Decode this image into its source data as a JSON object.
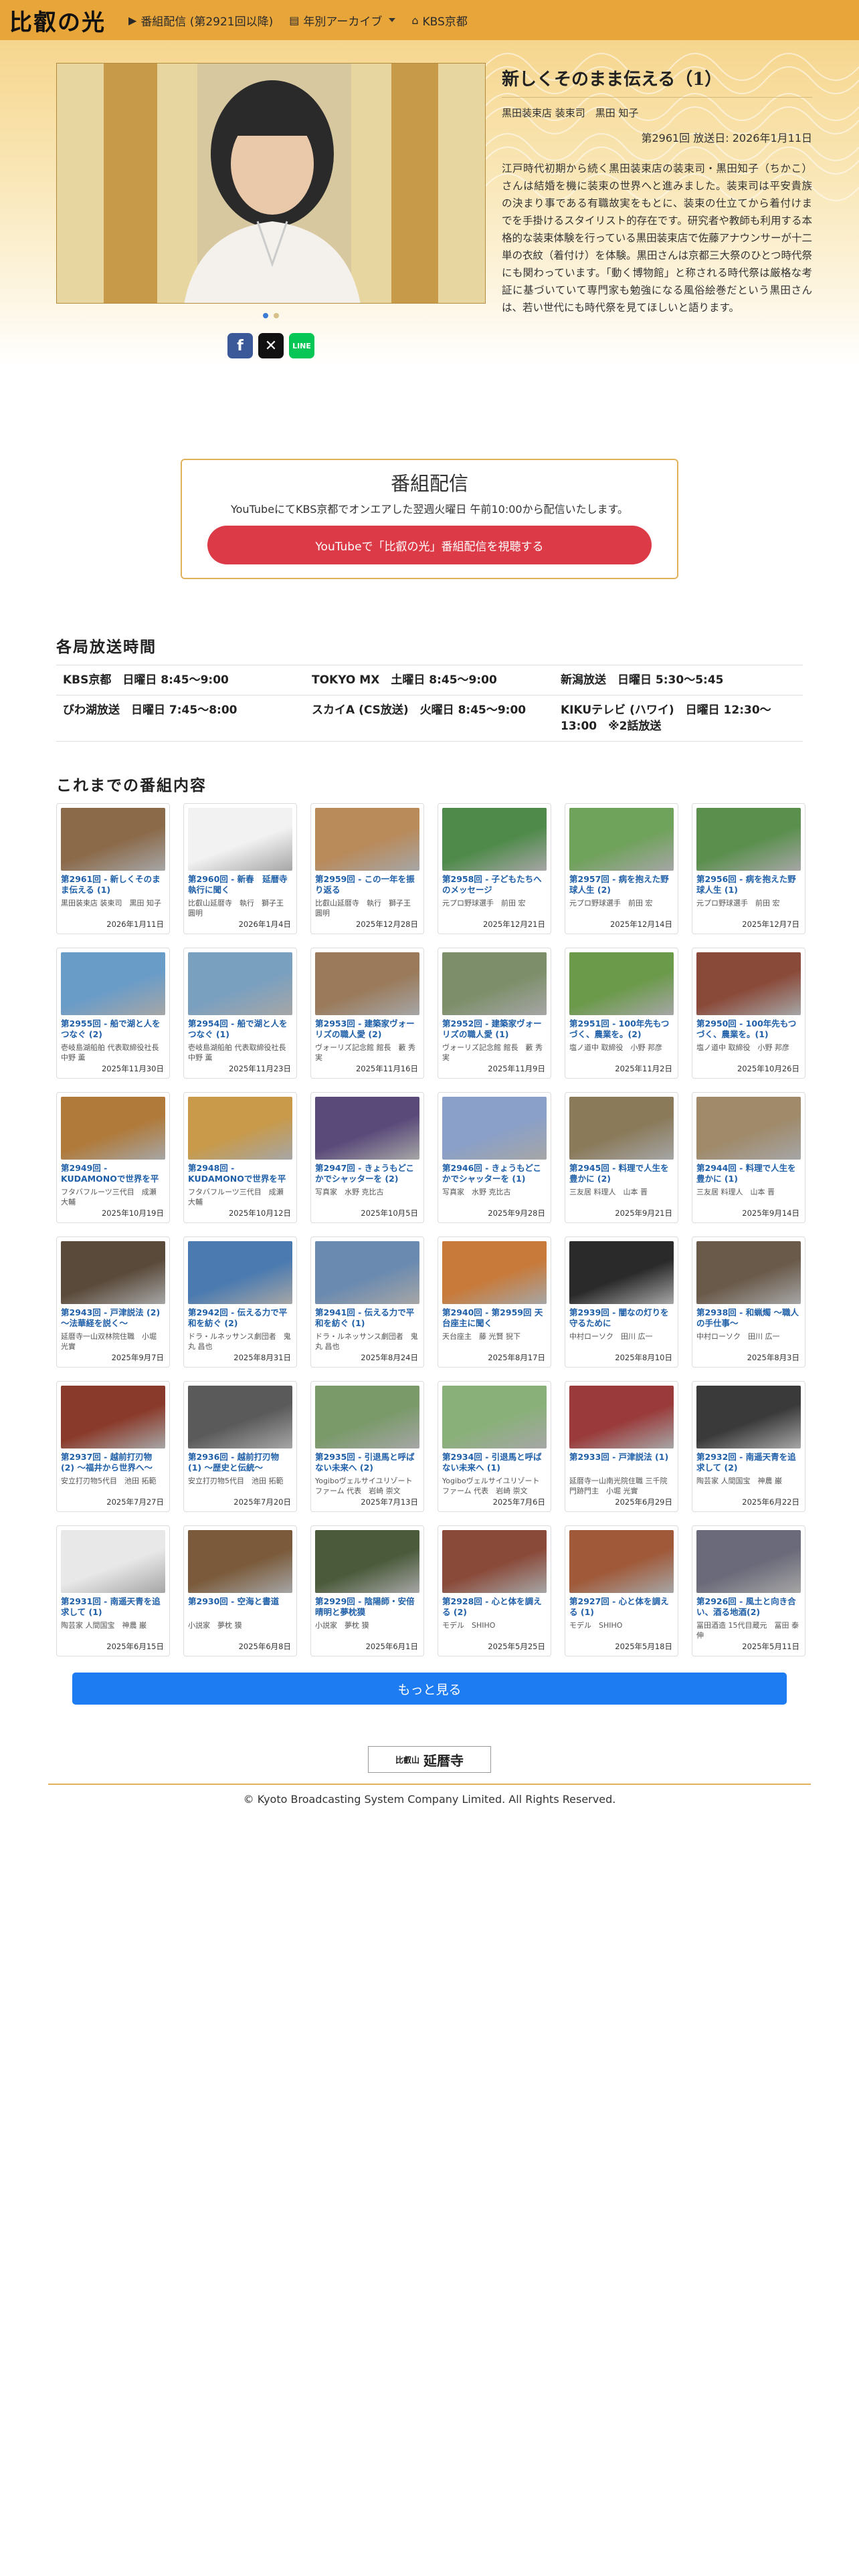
{
  "nav": {
    "brand": "比叡の光",
    "items": [
      {
        "icon": "video-icon",
        "label": "番組配信 (第2921回以降)"
      },
      {
        "icon": "archive-icon",
        "label": "年別アーカイブ"
      },
      {
        "icon": "home-icon",
        "label": "KBS京都"
      }
    ]
  },
  "hero": {
    "title": "新しくそのまま伝える（1）",
    "guest": "黒田装束店 装束司　黒田 知子",
    "airdate": "第2961回 放送日: 2026年1月11日",
    "summary": "江戸時代初期から続く黒田装束店の装束司・黒田知子（ちかこ）さんは結婚を機に装束の世界へと進みました。装束司は平安貴族の決まり事である有職故実をもとに、装束の仕立てから着付けまでを手掛けるスタイリスト的存在です。研究者や教師も利用する本格的な装束体験を行っている黒田装束店で佐藤アナウンサーが十二単の衣紋（着付け）を体験。黒田さんは京都三大祭のひとつ時代祭にも関わっています。「動く博物館」と称される時代祭は厳格な考証に基づいていて専門家も勉強になる風俗絵巻だという黒田さんは、若い世代にも時代祭を見てほしいと語ります。"
  },
  "streaming": {
    "heading": "番組配信",
    "text": "YouTubeにてKBS京都でオンエアした翌週火曜日 午前10:00から配信いたします。",
    "button": "YouTubeで「比叡の光」番組配信を視聴する"
  },
  "schedule": {
    "title": "各局放送時間",
    "rows": [
      [
        "KBS京都　日曜日 8:45〜9:00",
        "TOKYO MX　土曜日 8:45〜9:00",
        "新潟放送　日曜日 5:30〜5:45"
      ],
      [
        "びわ湖放送　日曜日 7:45〜8:00",
        "スカイA (CS放送)　火曜日 8:45〜9:00",
        "KIKUテレビ (ハワイ)　日曜日 12:30〜13:00　※2話放送"
      ]
    ]
  },
  "episodes": {
    "title": "これまでの番組内容",
    "items": [
      {
        "title": "第2961回 - 新しくそのまま伝える (1)",
        "guest": "黒田装束店 装束司　黒田 知子",
        "date": "2026年1月11日",
        "color": "#8b6a4a"
      },
      {
        "title": "第2960回 - 新春　延暦寺執行に聞く",
        "guest": "比叡山延暦寺　執行　獅子王 圓明",
        "date": "2026年1月4日",
        "color": "#f2f2f2"
      },
      {
        "title": "第2959回 - この一年を振り返る",
        "guest": "比叡山延暦寺　執行　獅子王 圓明",
        "date": "2025年12月28日",
        "color": "#b98a5a"
      },
      {
        "title": "第2958回 - 子どもたちへのメッセージ",
        "guest": "元プロ野球選手　前田 宏",
        "date": "2025年12月21日",
        "color": "#4f8a4a"
      },
      {
        "title": "第2957回 - 病を抱えた野球人生 (2)",
        "guest": "元プロ野球選手　前田 宏",
        "date": "2025年12月14日",
        "color": "#6fa25a"
      },
      {
        "title": "第2956回 - 病を抱えた野球人生 (1)",
        "guest": "元プロ野球選手　前田 宏",
        "date": "2025年12月7日",
        "color": "#5b8f4e"
      },
      {
        "title": "第2955回 - 船で湖と人をつなぐ (2)",
        "guest": "壱岐島湖船舶 代表取締役社長　中野 薫",
        "date": "2025年11月30日",
        "color": "#6a9cc8"
      },
      {
        "title": "第2954回 - 船で湖と人をつなぐ (1)",
        "guest": "壱岐島湖船舶 代表取締役社長　中野 薫",
        "date": "2025年11月23日",
        "color": "#7aa0c0"
      },
      {
        "title": "第2953回 - 建築家ヴォーリズの職人愛 (2)",
        "guest": "ヴォーリズ記念館 館長　藪 秀実",
        "date": "2025年11月16日",
        "color": "#9a7a5a"
      },
      {
        "title": "第2952回 - 建築家ヴォーリズの職人愛 (1)",
        "guest": "ヴォーリズ記念館 館長　藪 秀実",
        "date": "2025年11月9日",
        "color": "#7d8f6a"
      },
      {
        "title": "第2951回 - 100年先もつづく、農業を。(2)",
        "guest": "塩ノ道中 取締役　小野 邦彦",
        "date": "2025年11月2日",
        "color": "#6b9a4a"
      },
      {
        "title": "第2950回 - 100年先もつづく、農業を。(1)",
        "guest": "塩ノ道中 取締役　小野 邦彦",
        "date": "2025年10月26日",
        "color": "#8a4a3a"
      },
      {
        "title": "第2949回 - KUDAMONOで世界を平和に (2)",
        "guest": "フタバフルーツ三代目　成瀬 大輔",
        "date": "2025年10月19日",
        "color": "#b07a3a"
      },
      {
        "title": "第2948回 - KUDAMONOで世界を平和に (1)",
        "guest": "フタバフルーツ三代目　成瀬 大輔",
        "date": "2025年10月12日",
        "color": "#c89a4a"
      },
      {
        "title": "第2947回 - きょうもどこかでシャッターを (2)",
        "guest": "写真家　水野 克比古",
        "date": "2025年10月5日",
        "color": "#5a4a7a"
      },
      {
        "title": "第2946回 - きょうもどこかでシャッターを (1)",
        "guest": "写真家　水野 克比古",
        "date": "2025年9月28日",
        "color": "#8aa0c8"
      },
      {
        "title": "第2945回 - 料理で人生を豊かに (2)",
        "guest": "三友居 料理人　山本 晋",
        "date": "2025年9月21日",
        "color": "#8a7a5a"
      },
      {
        "title": "第2944回 - 料理で人生を豊かに (1)",
        "guest": "三友居 料理人　山本 晋",
        "date": "2025年9月14日",
        "color": "#a08a6a"
      },
      {
        "title": "第2943回 - 戸津説法 (2) 〜法華経を説く〜",
        "guest": "延暦寺一山双林院住職　小堀 光實",
        "date": "2025年9月7日",
        "color": "#5a4a3a"
      },
      {
        "title": "第2942回 - 伝える力で平和を紡ぐ (2)",
        "guest": "ドラ・ルネッサンス劇団者　鬼丸 昌也",
        "date": "2025年8月31日",
        "color": "#4a7ab0"
      },
      {
        "title": "第2941回 - 伝える力で平和を紡ぐ (1)",
        "guest": "ドラ・ルネッサンス劇団者　鬼丸 昌也",
        "date": "2025年8月24日",
        "color": "#6a8ab0"
      },
      {
        "title": "第2940回 - 第2959回 天台座主に聞く",
        "guest": "天台座主　藤 光賢 猊下",
        "date": "2025年8月17日",
        "color": "#c87a3a"
      },
      {
        "title": "第2939回 - 闇なの灯りを守るために",
        "guest": "中村ローソク　田川 広一",
        "date": "2025年8月10日",
        "color": "#2a2a2a"
      },
      {
        "title": "第2938回 - 和蝋燭 〜職人の手仕事〜",
        "guest": "中村ローソク　田川 広一",
        "date": "2025年8月3日",
        "color": "#6a5a4a"
      },
      {
        "title": "第2937回 - 越前打刃物 (2) 〜福井から世界へ〜",
        "guest": "安立打刃物5代目　池田 拓範",
        "date": "2025年7月27日",
        "color": "#8a3a2a"
      },
      {
        "title": "第2936回 - 越前打刃物 (1) 〜歴史と伝統〜",
        "guest": "安立打刃物5代目　池田 拓範",
        "date": "2025年7月20日",
        "color": "#5a5a5a"
      },
      {
        "title": "第2935回 - 引退馬と呼ばない未来へ (2)",
        "guest": "Yogiboヴェルサイユリゾートファーム 代表　岩崎 崇文",
        "date": "2025年7月13日",
        "color": "#7a9a6a"
      },
      {
        "title": "第2934回 - 引退馬と呼ばない未来へ (1)",
        "guest": "Yogiboヴェルサイユリゾートファーム 代表　岩崎 崇文",
        "date": "2025年7月6日",
        "color": "#8ab07a"
      },
      {
        "title": "第2933回 - 戸津説法 (1)",
        "guest": "延暦寺一山南光院住職 三千院門跡門主　小堀 光實",
        "date": "2025年6月29日",
        "color": "#9a3a3a"
      },
      {
        "title": "第2932回 - 南遥天青を追求して (2)",
        "guest": "陶芸家 人間国宝　神農 巌",
        "date": "2025年6月22日",
        "color": "#3a3a3a"
      },
      {
        "title": "第2931回 - 南遥天青を追求して (1)",
        "guest": "陶芸家 人間国宝　神農 巌",
        "date": "2025年6月15日",
        "color": "#e8e8e8"
      },
      {
        "title": "第2930回 - 空海と書道",
        "guest": "小説家　夢枕 獏",
        "date": "2025年6月8日",
        "color": "#7a5a3a"
      },
      {
        "title": "第2929回 - 陰陽師・安倍晴明と夢枕獏",
        "guest": "小説家　夢枕 獏",
        "date": "2025年6月1日",
        "color": "#4a5a3a"
      },
      {
        "title": "第2928回 - 心と体を調える (2)",
        "guest": "モデル　SHIHO",
        "date": "2025年5月25日",
        "color": "#8a4a3a"
      },
      {
        "title": "第2927回 - 心と体を調える (1)",
        "guest": "モデル　SHIHO",
        "date": "2025年5月18日",
        "color": "#a05a3a"
      },
      {
        "title": "第2926回 - 風土と向き合い、酒る地酒(2)",
        "guest": "冨田酒造 15代目蔵元　冨田 泰伸",
        "date": "2025年5月11日",
        "color": "#6a6a7a"
      }
    ],
    "more": "もっと見る"
  },
  "footer": {
    "sponsor_small": "比叡山",
    "sponsor": "延暦寺",
    "copyright": "© Kyoto Broadcasting System Company Limited. All Rights Reserved."
  },
  "colors": {
    "navbar": "#e8a63a",
    "accent_gold": "#e0b15a",
    "youtube_red": "#dd3a48",
    "link_blue": "#1f5fa8",
    "more_blue": "#1e7cf2"
  }
}
